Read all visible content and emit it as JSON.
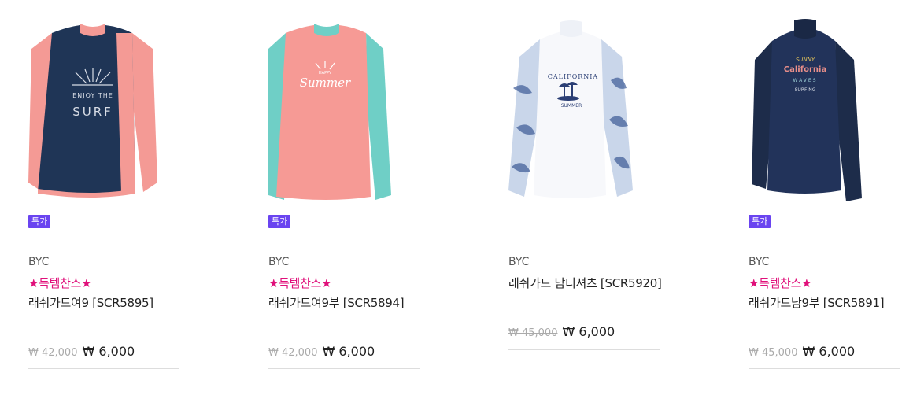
{
  "products": [
    {
      "badge": "특가",
      "brand": "BYC",
      "promo": "★득템찬스★",
      "name": "래쉬가드여9 [SCR5895]",
      "old_price": "₩ 42,000",
      "price": "₩ 6,000",
      "image": {
        "graphic_text_1": "ENJOY THE",
        "graphic_text_2": "SURF"
      }
    },
    {
      "badge": "특가",
      "brand": "BYC",
      "promo": "★득템찬스★",
      "name": "래쉬가드여9부 [SCR5894]",
      "old_price": "₩ 42,000",
      "price": "₩ 6,000",
      "image": {
        "graphic_text_1": "HAPPY",
        "graphic_text_2": "Summer"
      }
    },
    {
      "brand": "BYC",
      "name": "래쉬가드 남티셔츠 [SCR5920]",
      "old_price": "₩ 45,000",
      "price": "₩ 6,000",
      "image": {
        "graphic_text_1": "CALIFORNIA",
        "graphic_text_2": "SUMMER"
      }
    },
    {
      "badge": "특가",
      "brand": "BYC",
      "promo": "★득템찬스★",
      "name": "래쉬가드남9부 [SCR5891]",
      "old_price": "₩ 45,000",
      "price": "₩ 6,000",
      "image": {
        "graphic_text_1": "SUNNY",
        "graphic_text_2": "California",
        "graphic_text_3": "WAVES",
        "graphic_text_4": "SURFING"
      }
    }
  ],
  "colors": {
    "badge": "#6a44f0",
    "promo": "#e0107a"
  }
}
